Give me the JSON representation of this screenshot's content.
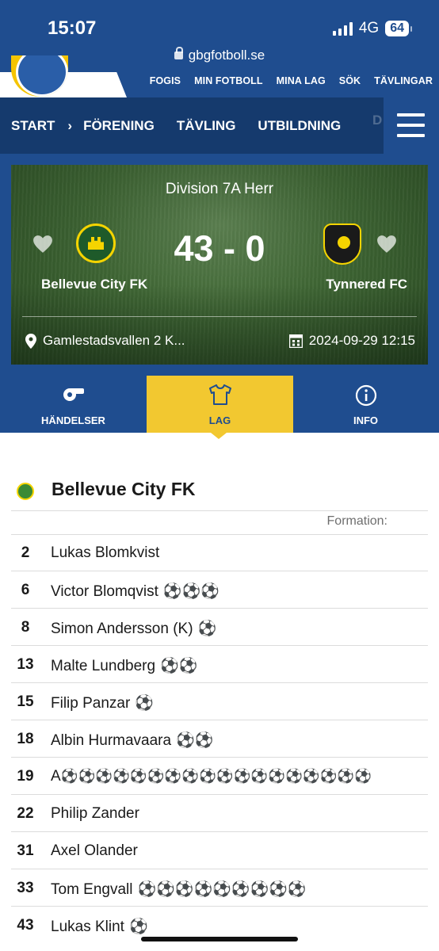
{
  "status_bar": {
    "time": "15:07",
    "network": "4G",
    "battery": "64"
  },
  "browser": {
    "url": "gbgfotboll.se"
  },
  "top_links": [
    "FOGIS",
    "MIN FOTBOLL",
    "MINA LAG",
    "SÖK",
    "TÄVLINGAR"
  ],
  "nav": {
    "items": [
      "START",
      "FÖRENING",
      "TÄVLING",
      "UTBILDNING",
      "D"
    ]
  },
  "match": {
    "division": "Division 7A Herr",
    "score": "43 - 0",
    "home_team": "Bellevue City FK",
    "away_team": "Tynnered FC",
    "venue": "Gamlestadsvallen 2 K...",
    "datetime": "2024-09-29 12:15"
  },
  "tabs": [
    {
      "label": "HÄNDELSER",
      "icon": "whistle-icon"
    },
    {
      "label": "LAG",
      "icon": "shirt-icon",
      "active": true
    },
    {
      "label": "INFO",
      "icon": "info-icon"
    }
  ],
  "lineup": {
    "team": "Bellevue City FK",
    "formation_label": "Formation:",
    "players": [
      {
        "number": "2",
        "name": "Lukas Blomkvist",
        "goals": ""
      },
      {
        "number": "6",
        "name": "Victor Blomqvist",
        "goals": "⚽⚽⚽"
      },
      {
        "number": "8",
        "name": "Simon Andersson (K)",
        "goals": "⚽"
      },
      {
        "number": "13",
        "name": "Malte Lundberg",
        "goals": "⚽⚽"
      },
      {
        "number": "15",
        "name": "Filip Panzar",
        "goals": "⚽"
      },
      {
        "number": "18",
        "name": "Albin Hurmavaara",
        "goals": "⚽⚽"
      },
      {
        "number": "19",
        "name": "A",
        "goals": "⚽⚽⚽⚽⚽⚽⚽⚽⚽⚽⚽⚽⚽⚽⚽⚽⚽⚽"
      },
      {
        "number": "22",
        "name": "Philip Zander",
        "goals": ""
      },
      {
        "number": "31",
        "name": "Axel Olander",
        "goals": ""
      },
      {
        "number": "33",
        "name": "Tom Engvall",
        "goals": "⚽⚽⚽⚽⚽⚽⚽⚽⚽"
      },
      {
        "number": "43",
        "name": "Lukas Klint",
        "goals": "⚽"
      }
    ]
  }
}
